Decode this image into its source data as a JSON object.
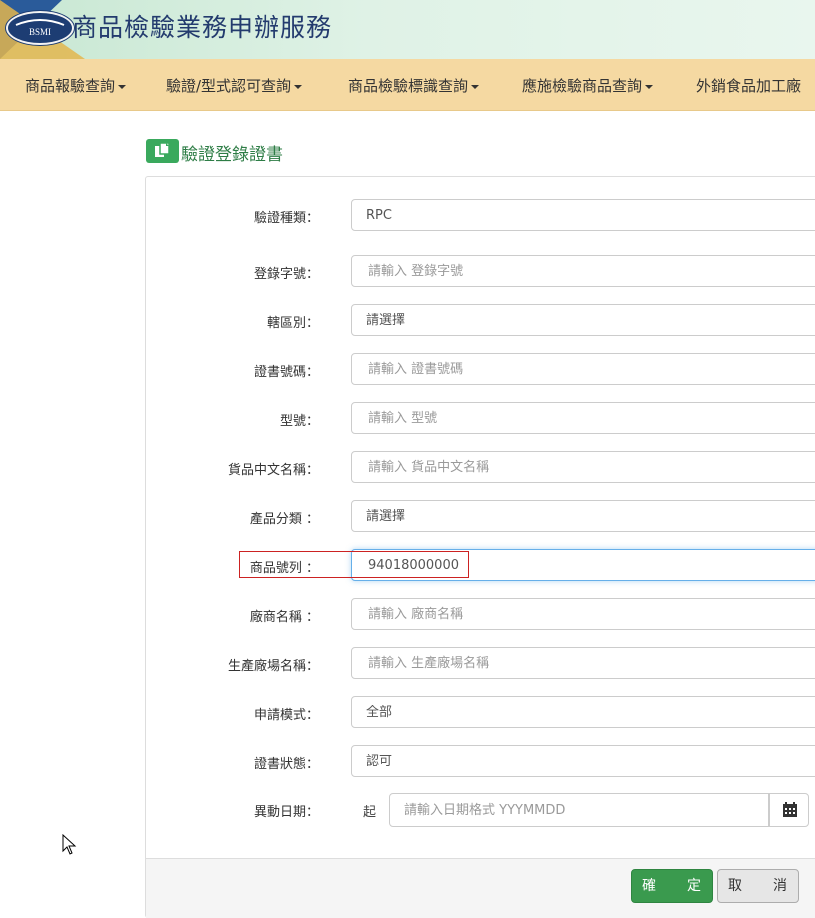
{
  "header": {
    "logo_text": "BSMI",
    "title": "商品檢驗業務申辦服務"
  },
  "nav": {
    "items": [
      {
        "label": "商品報驗查詢"
      },
      {
        "label": "驗證/型式認可查詢"
      },
      {
        "label": "商品檢驗標識查詢"
      },
      {
        "label": "應施檢驗商品查詢"
      },
      {
        "label": "外銷食品加工廠"
      }
    ]
  },
  "panel": {
    "title": "驗證登錄證書",
    "icon": "document-copy-icon"
  },
  "form": {
    "verification_type": {
      "label": "驗證種類：",
      "value": "RPC"
    },
    "registration_no": {
      "label": "登錄字號：",
      "placeholder": "請輸入 登錄字號"
    },
    "jurisdiction": {
      "label": "轄區別：",
      "value": "請選擇"
    },
    "certificate_no": {
      "label": "證書號碼：",
      "placeholder": "請輸入 證書號碼"
    },
    "model": {
      "label": "型號：",
      "placeholder": "請輸入 型號"
    },
    "product_cn_name": {
      "label": "貨品中文名稱：",
      "placeholder": "請輸入 貨品中文名稱"
    },
    "product_category": {
      "label": "產品分類 ：",
      "value": "請選擇"
    },
    "commodity_code": {
      "label": "商品號列 ：",
      "value": "94018000000"
    },
    "manufacturer_name": {
      "label": "廠商名稱 ：",
      "placeholder": "請輸入 廠商名稱"
    },
    "factory_name": {
      "label": "生產廠場名稱：",
      "placeholder": "請輸入 生產廠場名稱"
    },
    "application_mode": {
      "label": "申請模式：",
      "value": "全部"
    },
    "certificate_status": {
      "label": "證書狀態：",
      "value": "認可"
    },
    "change_date": {
      "label": "異動日期：",
      "start_label": "起",
      "placeholder": "請輸入日期格式 YYYMMDD",
      "icon": "calendar-icon"
    }
  },
  "buttons": {
    "ok": "確　　定",
    "cancel": "取　　消"
  },
  "colors": {
    "banner": "#dff2e6",
    "navbar": "#f5d9a2",
    "accent_green": "#3a9a4e",
    "title_green": "#2e7d46",
    "highlight_red": "#cc2222"
  }
}
